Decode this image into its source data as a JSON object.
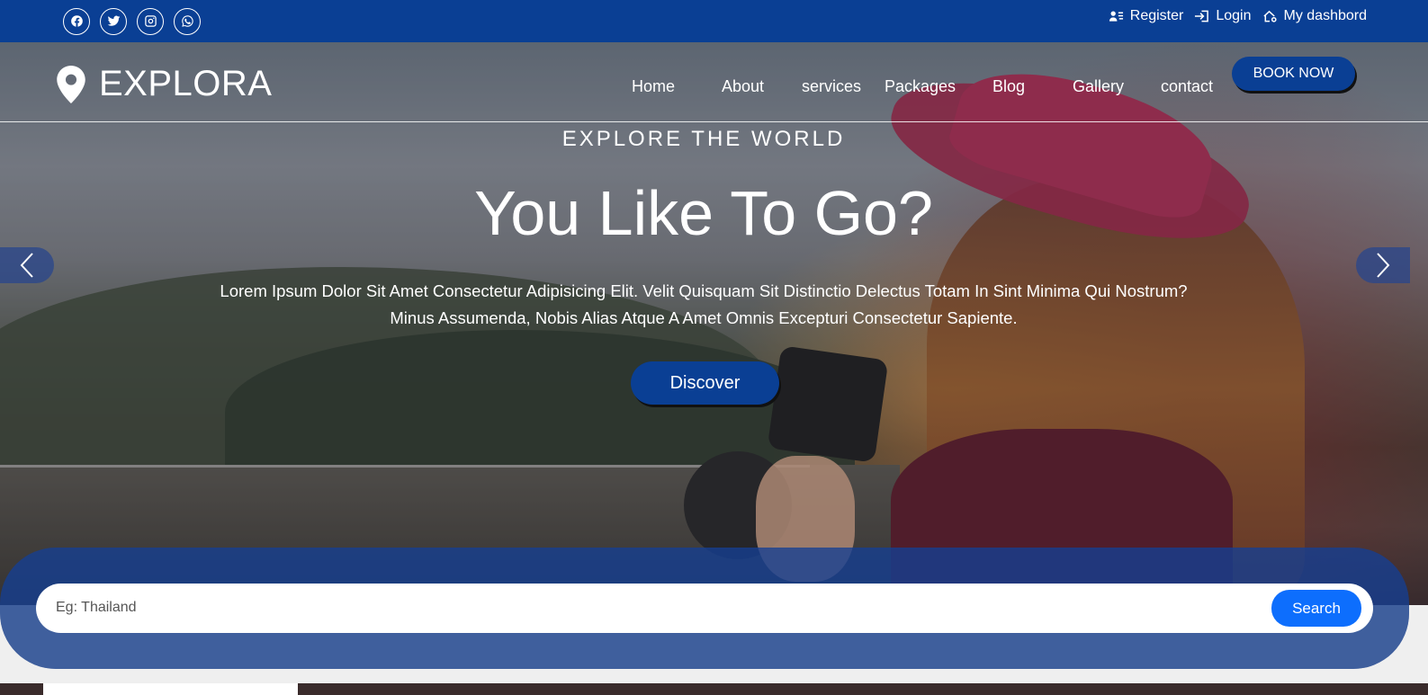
{
  "topbar": {
    "socials": [
      {
        "icon": "facebook-icon"
      },
      {
        "icon": "twitter-icon"
      },
      {
        "icon": "instagram-icon"
      },
      {
        "icon": "whatsapp-icon"
      }
    ],
    "links": {
      "register": "Register",
      "login": "Login",
      "dashboard": "My dashbord"
    }
  },
  "navbar": {
    "logo": "EXPLORA",
    "links": [
      "Home",
      "About",
      "services",
      "Packages",
      "Blog",
      "Gallery",
      "contact"
    ],
    "book_now": "BOOK NOW"
  },
  "hero": {
    "subtitle": "EXPLORE THE WORLD",
    "title": "You Like To Go?",
    "description_line1": "Lorem Ipsum Dolor Sit Amet Consectetur Adipisicing Elit. Velit Quisquam Sit Distinctio Delectus Totam In Sint Minima Qui Nostrum?",
    "description_line2": "Minus Assumenda, Nobis Alias Atque A Amet Omnis Excepturi Consectetur Sapiente.",
    "discover": "Discover"
  },
  "search": {
    "placeholder": "Eg: Thailand",
    "button": "Search"
  },
  "colors": {
    "primary": "#0a3f94",
    "search_button": "#0d6efd"
  }
}
